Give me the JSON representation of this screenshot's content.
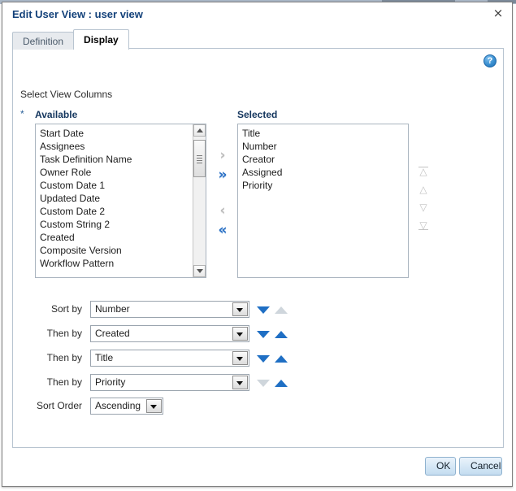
{
  "dialog": {
    "title": "Edit User View : user view",
    "close_label": "×",
    "help_label": "?"
  },
  "tabs": [
    {
      "label": "Definition",
      "active": false
    },
    {
      "label": "Display",
      "active": true
    }
  ],
  "content": {
    "section_label": "Select View Columns",
    "required_mark": "*",
    "available_header": "Available",
    "selected_header": "Selected",
    "available_items": [
      "Start Date",
      "Assignees",
      "Task Definition Name",
      "Owner Role",
      "Custom Date 1",
      "Updated Date",
      "Custom Date 2",
      "Custom String 2",
      "Created",
      "Composite Version",
      "Workflow Pattern"
    ],
    "selected_items": [
      "Title",
      "Number",
      "Creator",
      "Assigned",
      "Priority"
    ]
  },
  "transfer_buttons": [
    {
      "name": "move-right",
      "glyph": "›",
      "enabled": false
    },
    {
      "name": "move-all-right",
      "glyph": "»",
      "enabled": true
    },
    {
      "name": "move-left",
      "glyph": "‹",
      "enabled": false
    },
    {
      "name": "move-all-left",
      "glyph": "«",
      "enabled": true
    }
  ],
  "reorder_buttons": [
    {
      "name": "move-to-top",
      "glyph": "△",
      "enabled": false
    },
    {
      "name": "move-up",
      "glyph": "△",
      "enabled": false
    },
    {
      "name": "move-down",
      "glyph": "▽",
      "enabled": false
    },
    {
      "name": "move-to-bottom",
      "glyph": "▽",
      "enabled": false
    }
  ],
  "sort": {
    "rows": [
      {
        "label": "Sort by",
        "value": "Number",
        "down_enabled": true,
        "up_enabled": false
      },
      {
        "label": "Then by",
        "value": "Created",
        "down_enabled": true,
        "up_enabled": true
      },
      {
        "label": "Then by",
        "value": "Title",
        "down_enabled": true,
        "up_enabled": true
      },
      {
        "label": "Then by",
        "value": "Priority",
        "down_enabled": false,
        "up_enabled": true
      }
    ],
    "order_label": "Sort Order",
    "order_value": "Ascending"
  },
  "footer": {
    "ok_label": "OK",
    "cancel_label": "Cancel"
  },
  "colors": {
    "title": "#13417a",
    "accent_blue": "#2a6fc4",
    "disabled_grey": "#bdbdbd",
    "panel_border": "#b8c4d0"
  }
}
